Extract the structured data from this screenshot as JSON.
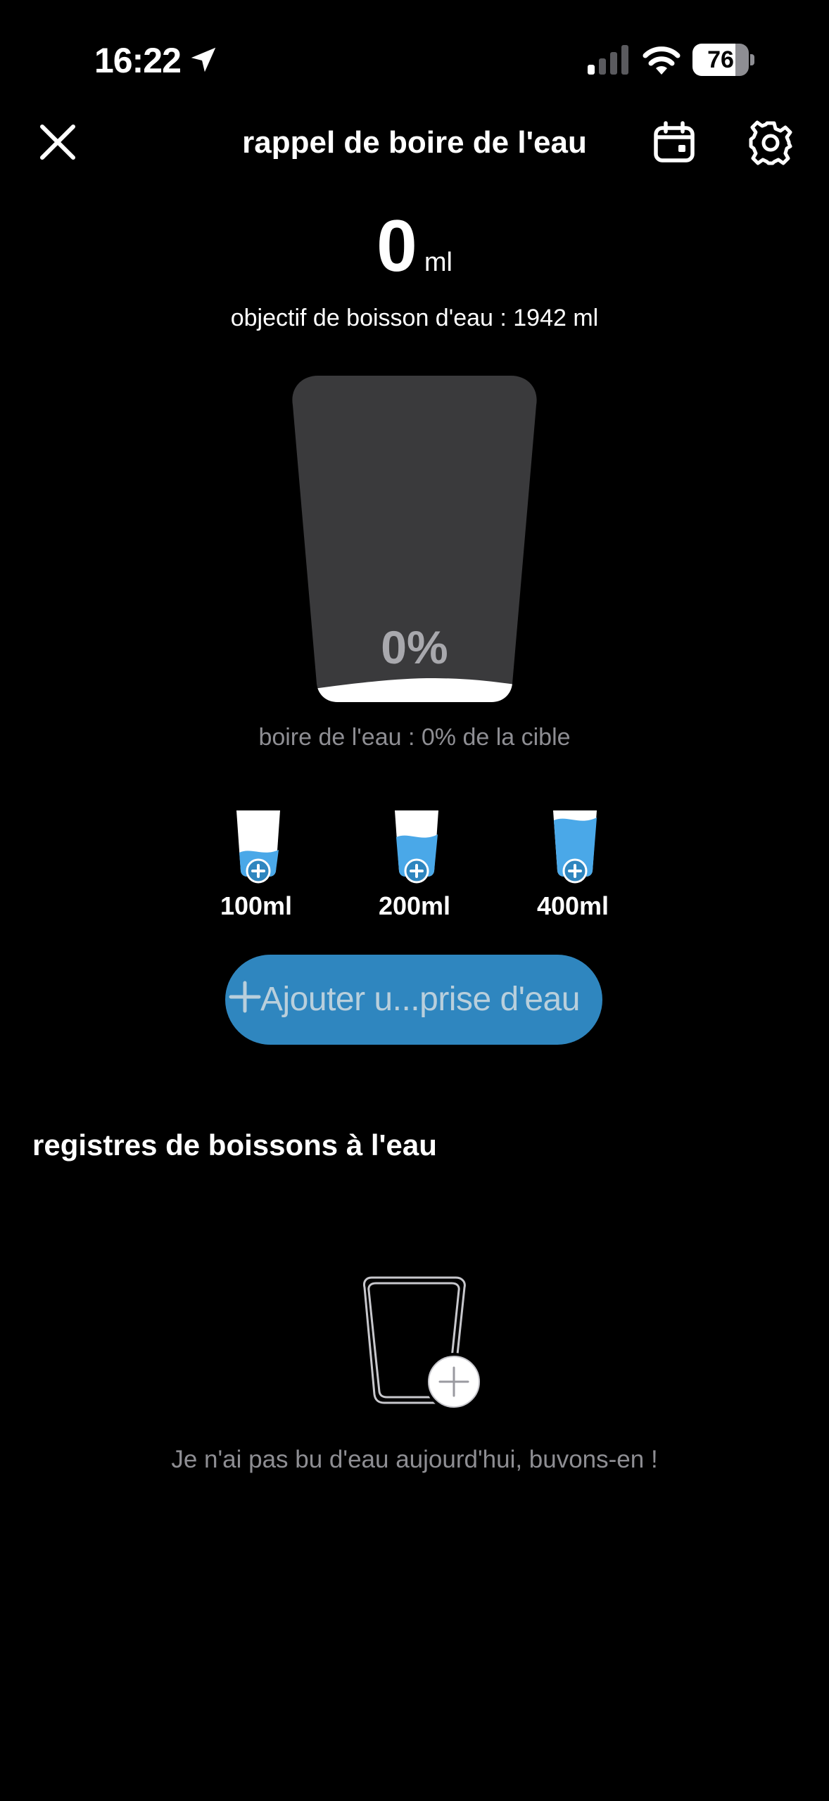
{
  "status_bar": {
    "time": "16:22",
    "battery": "76",
    "battery_level": 0.76,
    "icons": [
      "location-arrow-icon",
      "signal-icon",
      "wifi-icon",
      "battery-icon"
    ]
  },
  "nav": {
    "title": "rappel de boire de l'eau",
    "icons": [
      "close-icon",
      "calendar-icon",
      "gear-icon"
    ]
  },
  "intake": {
    "value": "0",
    "unit": "ml",
    "goal_text": "objectif de boisson d'eau : 1942 ml"
  },
  "glass": {
    "percent": "0%",
    "fill_fraction": 0,
    "progress_text": "boire de l'eau : 0% de la cible"
  },
  "quick_add": [
    {
      "label": "100ml",
      "fill_fraction": 0.35
    },
    {
      "label": "200ml",
      "fill_fraction": 0.55
    },
    {
      "label": "400ml",
      "fill_fraction": 0.8
    }
  ],
  "add_button": {
    "label": "Ajouter u...prise d'eau"
  },
  "records": {
    "title": "registres de boissons à l'eau",
    "empty_text": "Je n'ai pas bu d'eau aujourd'hui, buvons-en !"
  },
  "colors": {
    "background": "#000000",
    "accent": "#2f86bf",
    "water": "#4aa8e8",
    "glass": "#3a3a3c",
    "muted_text": "#8e8e93"
  }
}
